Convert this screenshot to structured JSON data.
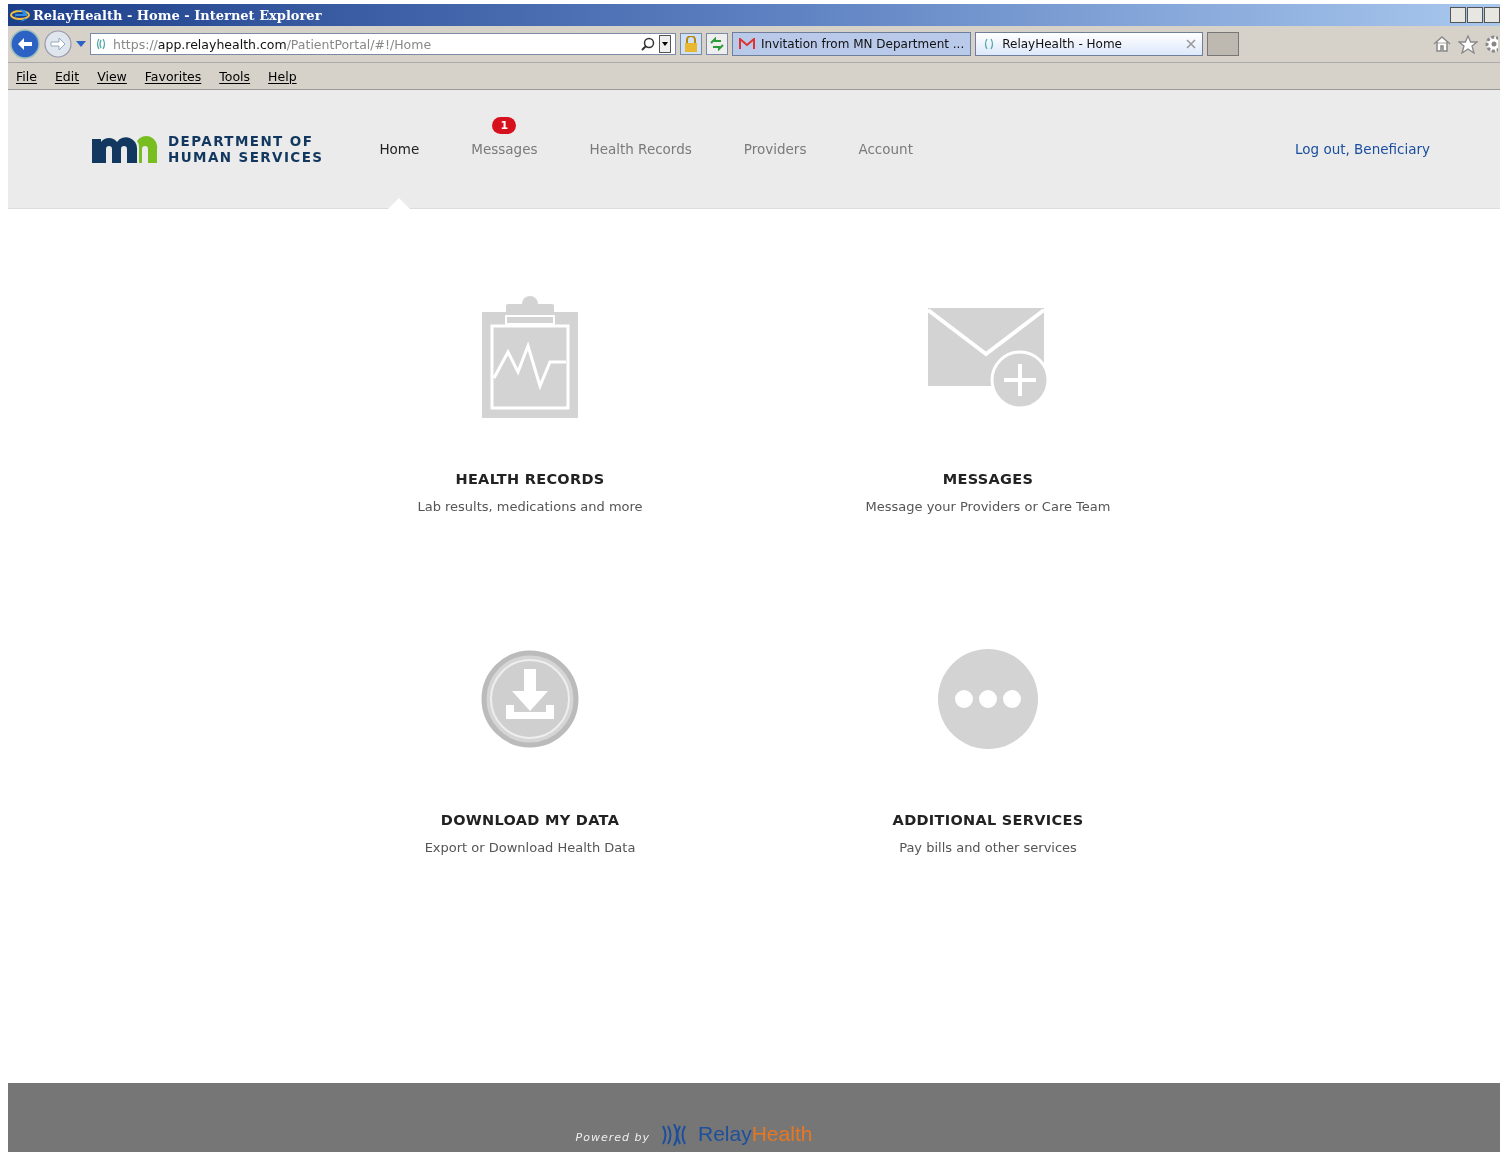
{
  "window": {
    "title": "RelayHealth - Home - Internet Explorer"
  },
  "address_bar": {
    "url_parts": [
      "https://",
      "app.relayhealth.com",
      "/PatientPortal/#!/Home"
    ]
  },
  "tabs": [
    {
      "label": "Invitation from MN Department ...",
      "selected": false,
      "kind": "mail"
    },
    {
      "label": "RelayHealth - Home",
      "selected": true,
      "kind": "site"
    }
  ],
  "menu": [
    "File",
    "Edit",
    "View",
    "Favorites",
    "Tools",
    "Help"
  ],
  "header": {
    "logo_lines": [
      "DEPARTMENT OF",
      "HUMAN SERVICES"
    ],
    "nav": [
      {
        "label": "Home",
        "selected": true
      },
      {
        "label": "Messages",
        "selected": false,
        "badge": "1"
      },
      {
        "label": "Health Records",
        "selected": false
      },
      {
        "label": "Providers",
        "selected": false
      },
      {
        "label": "Account",
        "selected": false
      }
    ],
    "logout": "Log out, Beneficiary"
  },
  "tiles": [
    {
      "kind": "records",
      "title": "HEALTH RECORDS",
      "subtitle": "Lab results, medications and more"
    },
    {
      "kind": "messages",
      "title": "MESSAGES",
      "subtitle": "Message your Providers or Care Team"
    },
    {
      "kind": "download",
      "title": "DOWNLOAD MY DATA",
      "subtitle": "Export or Download Health Data"
    },
    {
      "kind": "more",
      "title": "ADDITIONAL SERVICES",
      "subtitle": "Pay bills and other services"
    }
  ],
  "footer": {
    "powered_by": "Powered by",
    "brand_parts": [
      "Relay",
      "Health"
    ]
  }
}
